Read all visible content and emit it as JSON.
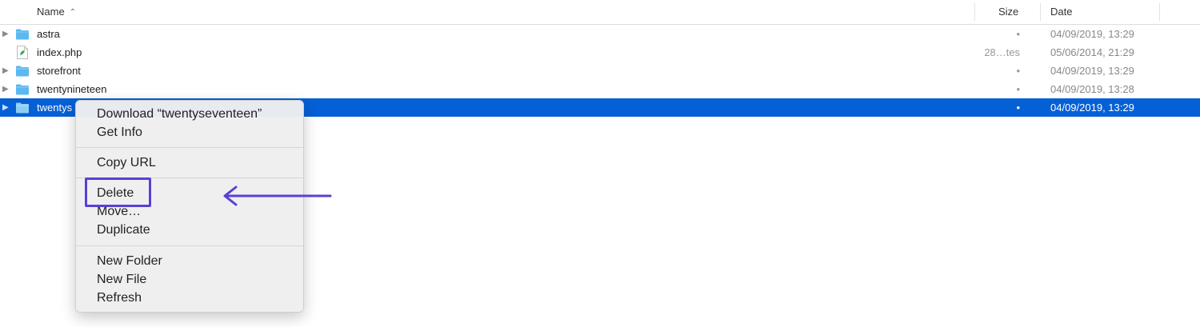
{
  "header": {
    "name_label": "Name",
    "size_label": "Size",
    "date_label": "Date"
  },
  "files": [
    {
      "name": "astra",
      "type": "folder",
      "size": "•",
      "date": "04/09/2019, 13:29"
    },
    {
      "name": "index.php",
      "type": "php-file",
      "size": "28…tes",
      "date": "05/06/2014, 21:29"
    },
    {
      "name": "storefront",
      "type": "folder",
      "size": "•",
      "date": "04/09/2019, 13:29"
    },
    {
      "name": "twentynineteen",
      "type": "folder",
      "size": "•",
      "date": "04/09/2019, 13:28"
    },
    {
      "name": "twentys",
      "type": "folder",
      "size": "•",
      "date": "04/09/2019, 13:29",
      "selected": true
    }
  ],
  "context_menu": {
    "download": "Download “twentyseventeen”",
    "get_info": "Get Info",
    "copy_url": "Copy URL",
    "delete": "Delete",
    "move": "Move…",
    "duplicate": "Duplicate",
    "new_folder": "New Folder",
    "new_file": "New File",
    "refresh": "Refresh"
  },
  "colors": {
    "selection": "#0560d6",
    "folder": "#5bb8f0",
    "annotation": "#5b3fd6"
  },
  "icons": {
    "sort": "chevron-up-icon",
    "folder": "folder-icon",
    "php": "php-file-icon",
    "disclosure": "disclosure-triangle-icon",
    "arrow": "arrow-left-icon"
  }
}
